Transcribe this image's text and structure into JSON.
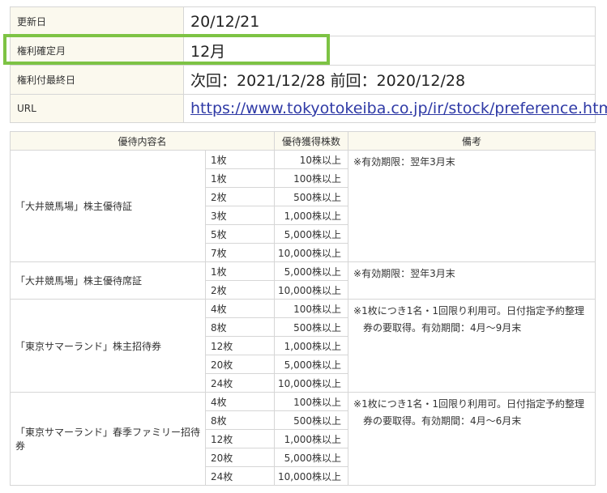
{
  "info": {
    "updated": {
      "label": "更新日",
      "value": "20/12/21"
    },
    "record_month": {
      "label": "権利確定月",
      "value": "12月"
    },
    "last_day": {
      "label": "権利付最終日",
      "value": "次回：2021/12/28 前回：2020/12/28"
    },
    "url": {
      "label": "URL",
      "value": "https://www.tokyotokeiba.co.jp/ir/stock/preference.html"
    }
  },
  "benefits": {
    "headers": [
      "優待内容名",
      "優待獲得株数",
      "備考"
    ],
    "groups": [
      {
        "name": "「大井競馬場」株主優待証",
        "rows": [
          [
            "1枚",
            "10株以上"
          ],
          [
            "1枚",
            "100株以上"
          ],
          [
            "2枚",
            "500株以上"
          ],
          [
            "3枚",
            "1,000株以上"
          ],
          [
            "5枚",
            "5,000株以上"
          ],
          [
            "7枚",
            "10,000株以上"
          ]
        ],
        "note": "※有効期限：翌年3月末"
      },
      {
        "name": "「大井競馬場」株主優待席証",
        "rows": [
          [
            "1枚",
            "5,000株以上"
          ],
          [
            "2枚",
            "10,000株以上"
          ]
        ],
        "note": "※有効期限：翌年3月末"
      },
      {
        "name": "「東京サマーランド」株主招待券",
        "rows": [
          [
            "4枚",
            "100株以上"
          ],
          [
            "8枚",
            "500株以上"
          ],
          [
            "12枚",
            "1,000株以上"
          ],
          [
            "20枚",
            "5,000株以上"
          ],
          [
            "24枚",
            "10,000株以上"
          ]
        ],
        "note": "※1枚につき1名・1回限り利用可。日付指定予約整理券の要取得。有効期間：4月〜9月末"
      },
      {
        "name": "「東京サマーランド」春季ファミリー招待券",
        "rows": [
          [
            "4枚",
            "100株以上"
          ],
          [
            "8枚",
            "500株以上"
          ],
          [
            "12枚",
            "1,000株以上"
          ],
          [
            "20枚",
            "5,000株以上"
          ],
          [
            "24枚",
            "10,000株以上"
          ]
        ],
        "note": "※1枚につき1名・1回限り利用可。日付指定予約整理券の要取得。有効期間：4月〜6月末"
      }
    ]
  },
  "colors": {
    "highlight": "#7dc344",
    "label_bg": "#fbf9ee",
    "link": "#2f3aa6",
    "border": "#d6d6d6"
  }
}
